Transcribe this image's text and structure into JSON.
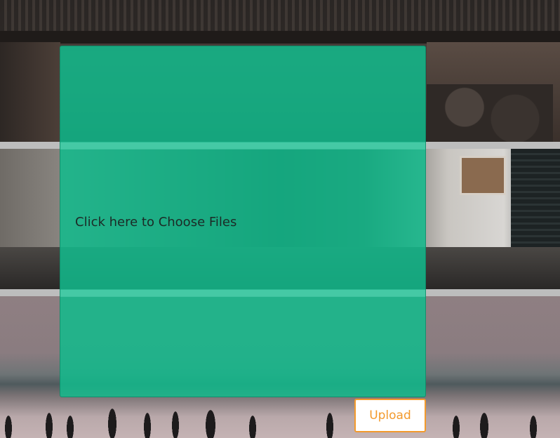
{
  "dropzone": {
    "prompt": "Click here to Choose Files"
  },
  "upload": {
    "label": "Upload"
  },
  "colors": {
    "dropzone_bg": "#12ba8c",
    "button_accent": "#f39a2c"
  }
}
